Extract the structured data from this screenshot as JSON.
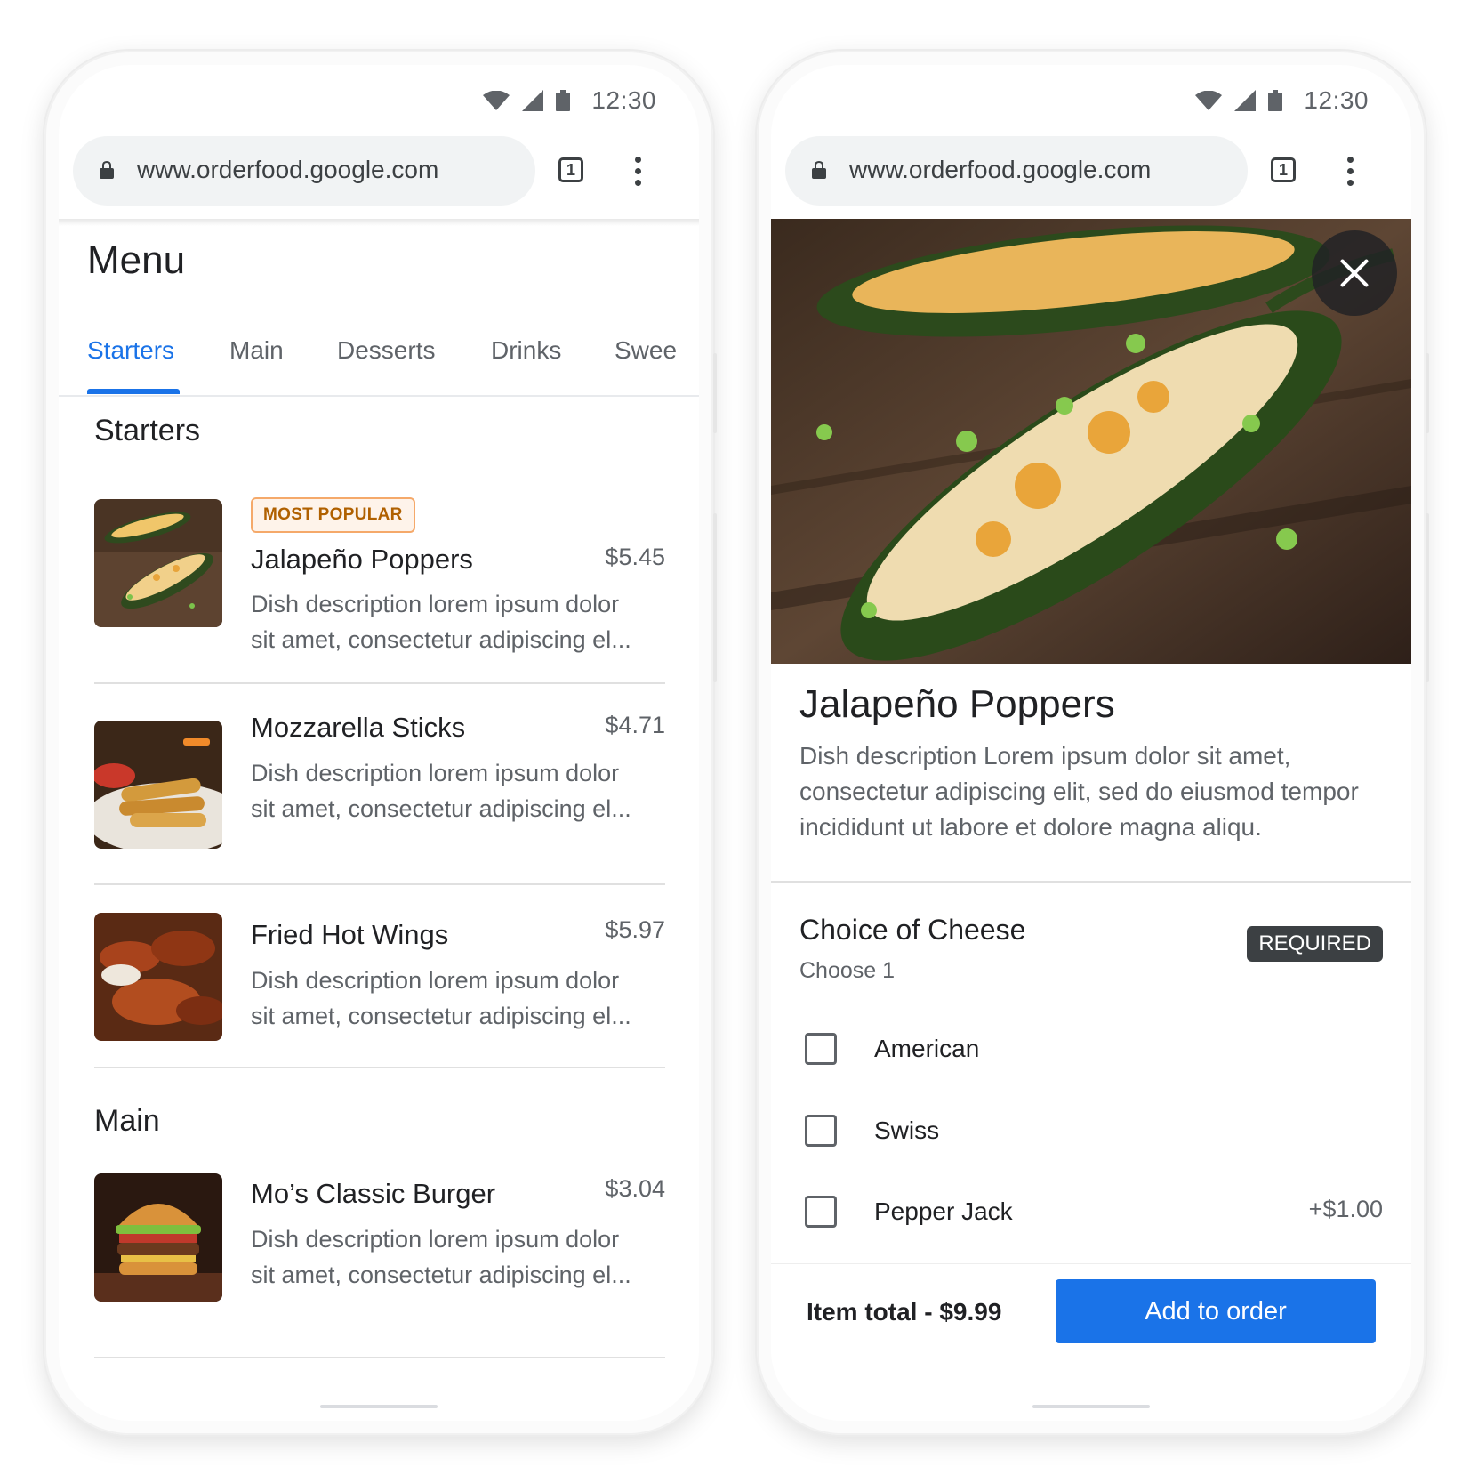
{
  "status_bar": {
    "time": "12:30"
  },
  "browser": {
    "url": "www.orderfood.google.com",
    "tab_count": "1",
    "lock_icon": "lock-icon",
    "more_icon": "more-vert-icon"
  },
  "menu_screen": {
    "title": "Menu",
    "tabs": [
      {
        "label": "Starters",
        "active": true
      },
      {
        "label": "Main",
        "active": false
      },
      {
        "label": "Desserts",
        "active": false
      },
      {
        "label": "Drinks",
        "active": false
      },
      {
        "label": "Swee",
        "active": false
      }
    ],
    "sections": [
      {
        "title": "Starters",
        "items": [
          {
            "badge": "MOST POPULAR",
            "name": "Jalapeño Poppers",
            "price": "$5.45",
            "desc_line1": "Dish description lorem ipsum dolor",
            "desc_line2": "sit amet, consectetur adipiscing el..."
          },
          {
            "name": "Mozzarella Sticks",
            "price": "$4.71",
            "desc_line1": "Dish description lorem ipsum dolor",
            "desc_line2": "sit amet, consectetur adipiscing el..."
          },
          {
            "name": "Fried Hot Wings",
            "price": "$5.97",
            "desc_line1": "Dish description lorem ipsum dolor",
            "desc_line2": "sit amet, consectetur adipiscing el..."
          }
        ]
      },
      {
        "title": "Main",
        "items": [
          {
            "name": "Mo’s Classic Burger",
            "price": "$3.04",
            "desc_line1": "Dish description lorem ipsum dolor",
            "desc_line2": "sit amet, consectetur adipiscing el..."
          }
        ]
      }
    ]
  },
  "detail_screen": {
    "title": "Jalapeño Poppers",
    "desc_line1": "Dish description Lorem ipsum dolor sit amet,",
    "desc_line2": "consectetur adipiscing elit, sed do eiusmod tempor",
    "desc_line3": "incididunt ut labore et dolore magna aliqu.",
    "choice_group": {
      "title": "Choice of Cheese",
      "subtitle": "Choose 1",
      "badge": "REQUIRED",
      "options": [
        {
          "label": "American",
          "price": "",
          "checked": false
        },
        {
          "label": "Swiss",
          "price": "",
          "checked": false
        },
        {
          "label": "Pepper Jack",
          "price": "+$1.00",
          "checked": false
        }
      ]
    },
    "footer": {
      "total": "Item total - $9.99",
      "button": "Add to order"
    }
  },
  "colors": {
    "accent": "#1a73e8",
    "badge_popular": "#b06000",
    "badge_required": "#3c4043"
  }
}
